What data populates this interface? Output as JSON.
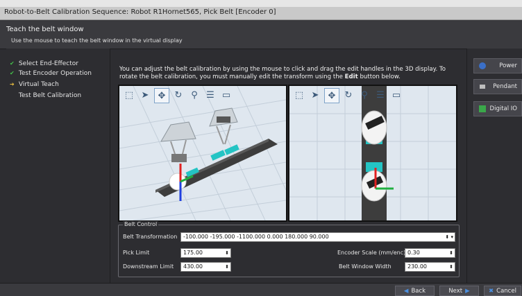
{
  "window": {
    "title": "Robot-to-Belt Calibration Sequence: Robot R1Hornet565, Pick Belt [Encoder 0]"
  },
  "header": {
    "heading": "Teach the belt window",
    "subtitle": "Use the mouse to teach the belt window in the virtual display"
  },
  "steps": [
    {
      "label": "Select End-Effector",
      "state": "done"
    },
    {
      "label": "Test Encoder Operation",
      "state": "done"
    },
    {
      "label": "Virtual Teach",
      "state": "current"
    },
    {
      "label": "Test Belt Calibration",
      "state": "pending"
    }
  ],
  "instructions": {
    "part1": "You can adjust the belt calibration by using the mouse to click and drag the edit handles in the 3D display. To rotate the belt calibration, you must manually edit the transform using the ",
    "emph": "Edit",
    "part2": " button below."
  },
  "viewport_toolbar_icons": [
    "view-cube-icon",
    "select-arrow-icon",
    "pan-icon",
    "rotate-icon",
    "zoom-icon",
    "edit-properties-icon",
    "ruler-icon"
  ],
  "belt_control": {
    "legend": "Belt Control",
    "transformation_label": "Belt Transformation",
    "transformation_value": "-100.000 -195.000 -1100.000 0.000 180.000 90.000",
    "pick_limit_label": "Pick Limit",
    "pick_limit_value": "175.00",
    "downstream_limit_label": "Downstream Limit",
    "downstream_limit_value": "430.00",
    "encoder_scale_label": "Encoder Scale (mm/enc):",
    "encoder_scale_value": "0.30",
    "belt_window_width_label": "Belt Window Width",
    "belt_window_width_value": "230.00"
  },
  "right_panel": {
    "power_label": "Power",
    "pendant_label": "Pendant",
    "digital_io_label": "Digital IO"
  },
  "footer": {
    "back_label": "Back",
    "next_label": "Next",
    "cancel_label": "Cancel"
  }
}
